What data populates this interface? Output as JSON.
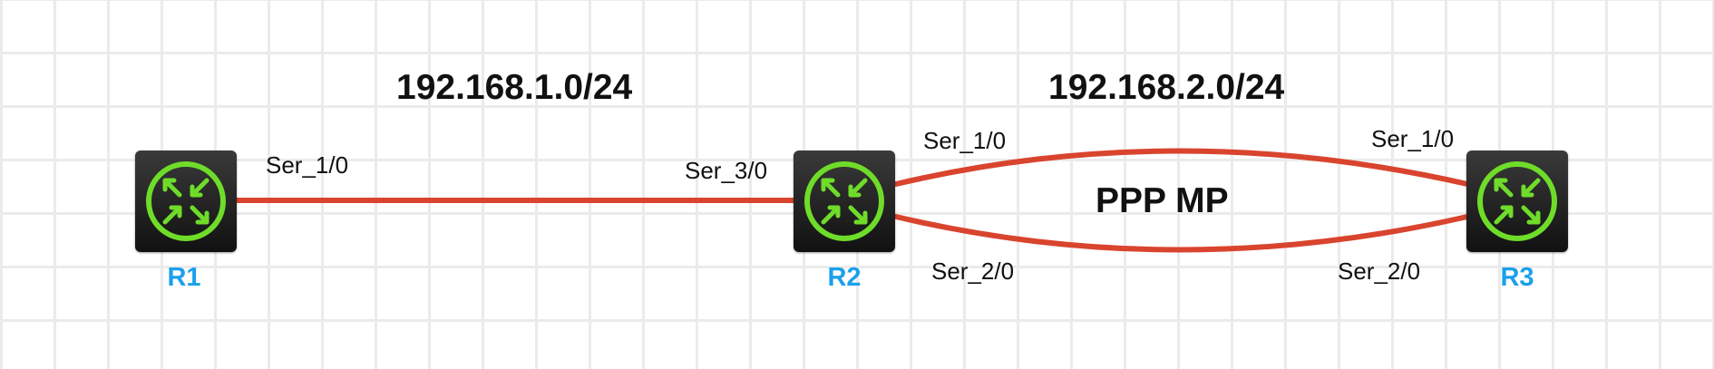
{
  "networks": {
    "net1": "192.168.1.0/24",
    "net2": "192.168.2.0/24"
  },
  "bundle_label": "PPP MP",
  "routers": {
    "r1": {
      "name": "R1"
    },
    "r2": {
      "name": "R2"
    },
    "r3": {
      "name": "R3"
    }
  },
  "interfaces": {
    "r1_ser_1_0": "Ser_1/0",
    "r2_ser_3_0": "Ser_3/0",
    "r2_ser_1_0": "Ser_1/0",
    "r2_ser_2_0": "Ser_2/0",
    "r3_ser_1_0": "Ser_1/0",
    "r3_ser_2_0": "Ser_2/0"
  },
  "colors": {
    "link": "#d9442e",
    "router_body": "#1a1a1a",
    "router_icon": "#6fdc2a",
    "router_name": "#1aa0ec",
    "grid": "#ebebeb"
  },
  "icons": {
    "router": "router-icon"
  }
}
